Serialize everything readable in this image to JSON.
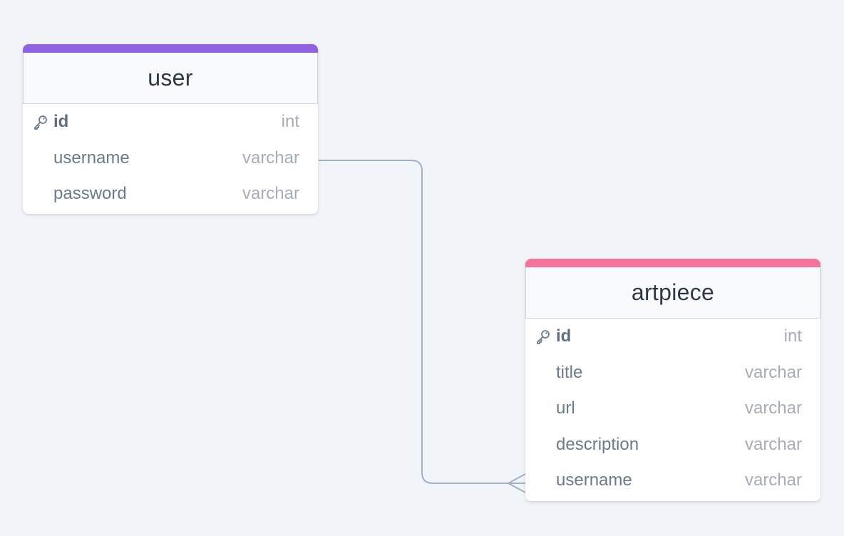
{
  "colors": {
    "background": "#f1f5f9",
    "user_accent": "#9061e0",
    "artpiece_accent": "#f5739c",
    "connector": "#a3b1c6"
  },
  "tables": {
    "user": {
      "name": "user",
      "columns": [
        {
          "name": "id",
          "type": "int",
          "primary_key": true
        },
        {
          "name": "username",
          "type": "varchar",
          "primary_key": false
        },
        {
          "name": "password",
          "type": "varchar",
          "primary_key": false
        }
      ]
    },
    "artpiece": {
      "name": "artpiece",
      "columns": [
        {
          "name": "id",
          "type": "int",
          "primary_key": true
        },
        {
          "name": "title",
          "type": "varchar",
          "primary_key": false
        },
        {
          "name": "url",
          "type": "varchar",
          "primary_key": false
        },
        {
          "name": "description",
          "type": "varchar",
          "primary_key": false
        },
        {
          "name": "username",
          "type": "varchar",
          "primary_key": false
        }
      ]
    }
  },
  "relationship": {
    "from": "user.username",
    "to": "artpiece.username",
    "from_cardinality": "one",
    "to_cardinality": "many"
  }
}
